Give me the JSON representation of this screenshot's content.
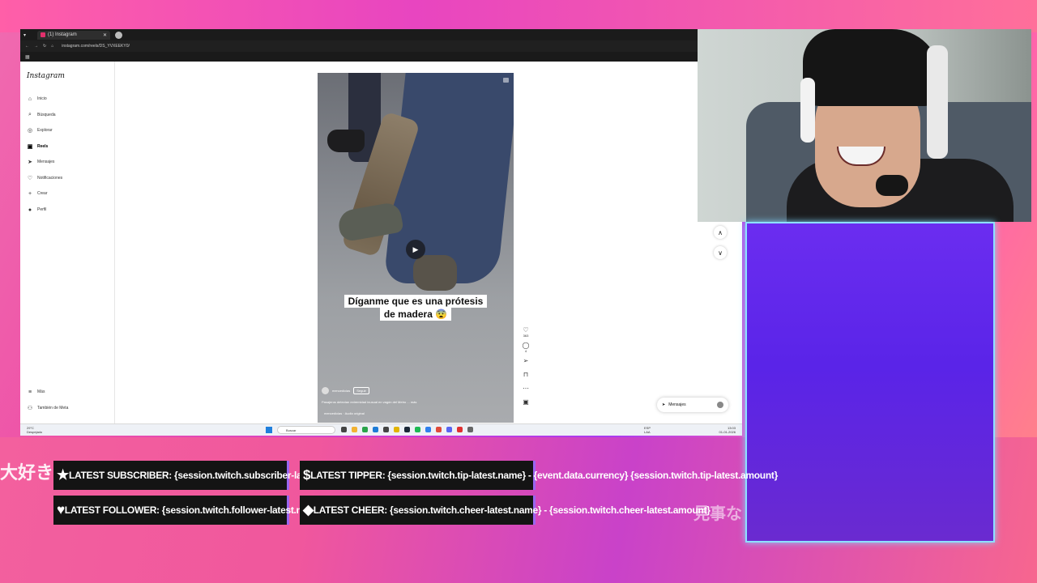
{
  "browser": {
    "tab_title": "(1) Instagram",
    "tab_close": "✕",
    "url": "instagram.com/reels/DS_YVXEEKY0/"
  },
  "sidebar": {
    "logo": "Instagram",
    "items": [
      {
        "label": "Inicio",
        "icon": "home-icon",
        "glyph": "⌂"
      },
      {
        "label": "Búsqueda",
        "icon": "search-icon",
        "glyph": "⌕"
      },
      {
        "label": "Explorar",
        "icon": "compass-icon",
        "glyph": "◎"
      },
      {
        "label": "Reels",
        "icon": "reels-icon",
        "glyph": "▣"
      },
      {
        "label": "Mensajes",
        "icon": "messenger-icon",
        "glyph": "➤"
      },
      {
        "label": "Notificaciones",
        "icon": "heart-icon",
        "glyph": "♡"
      },
      {
        "label": "Crear",
        "icon": "plus-icon",
        "glyph": "+"
      },
      {
        "label": "Perfil",
        "icon": "profile-icon",
        "glyph": "●"
      }
    ],
    "more": {
      "label": "Más",
      "glyph": "≡"
    },
    "meta": {
      "label": "También de Meta",
      "glyph": "⚇"
    }
  },
  "reel": {
    "caption_line1": "Díganme que es una prótesis",
    "caption_line2": "de madera 😨",
    "username": "mencedicias",
    "follow_label": "Seguir",
    "description": "Pasajeros detectan extremidad inusual en vagón del Metro ... más",
    "audio": "mencedicias · Audio original",
    "likes": "363",
    "comments": "4"
  },
  "messages_pill": {
    "label": "Mensajes"
  },
  "taskbar": {
    "weather_temp": "29°C",
    "weather_text": "Despejado",
    "search_placeholder": "Buscar",
    "lang": "ESP",
    "lang2": "LAA",
    "time": "13:03",
    "date": "01-01-2026"
  },
  "alerts": {
    "subscriber": "LATEST SUBSCRIBER: {session.twitch.subscriber-latest.name}",
    "tipper": "LATEST TIPPER: {session.twitch.tip-latest.name} - {event.data.currency} {session.twitch.tip-latest.amount}",
    "follower": "LATEST FOLLOWER: {session.twitch.follower-latest.name}",
    "cheer": "LATEST CHEER: {session.twitch.cheer-latest.name} - {session.twitch.cheer-latest.amount}"
  },
  "overlay_text": {
    "left": "大好き",
    "right": "見事な"
  }
}
